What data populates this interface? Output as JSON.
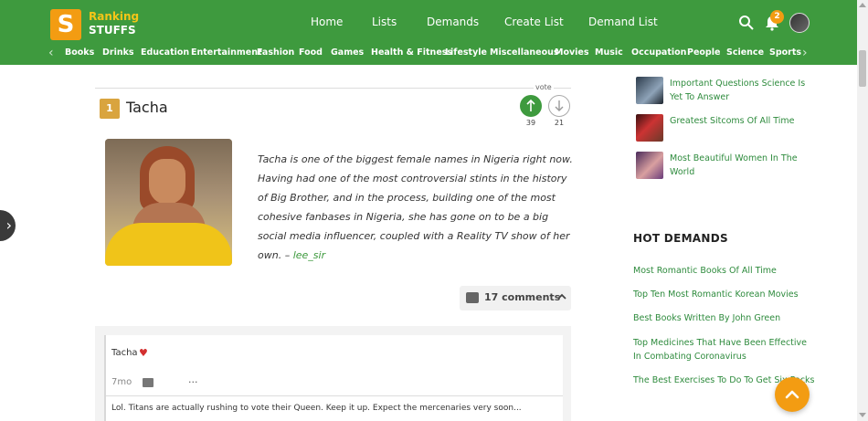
{
  "brand": {
    "line1": "Ranking",
    "line2": "STUFFS",
    "mark": "S"
  },
  "nav": [
    "Home",
    "Lists",
    "Demands",
    "Create List",
    "Demand List"
  ],
  "notifications": {
    "count": "2"
  },
  "categories": [
    "Books",
    "Drinks",
    "Education",
    "Entertainment",
    "Fashion",
    "Food",
    "Games",
    "Health & Fitness",
    "Lifestyle",
    "Miscellaneous",
    "Movies",
    "Music",
    "Occupation",
    "People",
    "Science",
    "Sports"
  ],
  "item": {
    "rank": "1",
    "title": "Tacha",
    "vote_label": "vote",
    "upvotes": "39",
    "downvotes": "21",
    "description": "Tacha is one of the biggest female names in Nigeria right now. Having had one of the most controversial stints in the history of Big Brother, and in the process, building one of the most cohesive fanbases in Nigeria, she has gone on to be a big social media influencer, coupled with a Reality TV show of her own. – ",
    "author": "lee_sir"
  },
  "comments": {
    "toggle_label": "17 comments",
    "list": [
      {
        "author": "Tacha",
        "time": "7mo",
        "more": "...",
        "text": "Lol. Titans are actually rushing to vote their Queen. Keep it up. Expect the mercenaries very soon..."
      }
    ]
  },
  "related": [
    {
      "title": "Important Questions Science Is Yet To Answer"
    },
    {
      "title": "Greatest Sitcoms Of All Time"
    },
    {
      "title": "Most Beautiful Women In The World"
    }
  ],
  "hot_demands": {
    "heading": "HOT DEMANDS",
    "items": [
      "Most Romantic Books Of All Time",
      "Top Ten Most Romantic Korean Movies",
      "Best Books Written By John Green",
      "Top Medicines That Have Been Effective In Combating Coronavirus",
      "The Best Exercises To Do To Get Six Packs"
    ]
  },
  "colors": {
    "brand_green": "#3e9a3e",
    "accent_orange": "#f39c12",
    "link_green": "#2e8b3d"
  }
}
